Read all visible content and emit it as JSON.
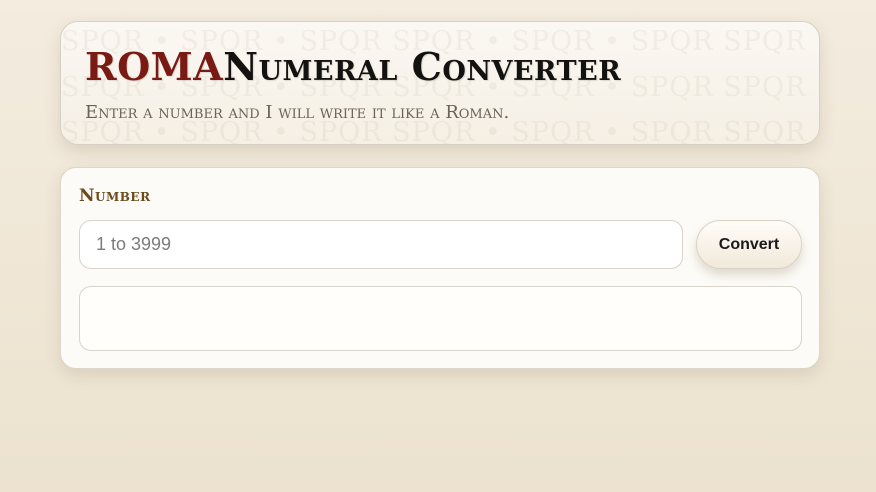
{
  "header": {
    "title_accent": "ROMA",
    "title_rest": "Numeral Converter",
    "subtitle": "Enter a number and I will write it like a Roman.",
    "watermark": "SPQR • SPQR • SPQR    SPQR • SPQR • SPQR    SPQR"
  },
  "form": {
    "number_label": "Number",
    "input_value": "",
    "input_placeholder": "1 to 3999",
    "convert_label": "Convert",
    "output": ""
  },
  "colors": {
    "accent": "#7a1a14",
    "label": "#6b4a1c",
    "background": "#f3ecdf"
  }
}
